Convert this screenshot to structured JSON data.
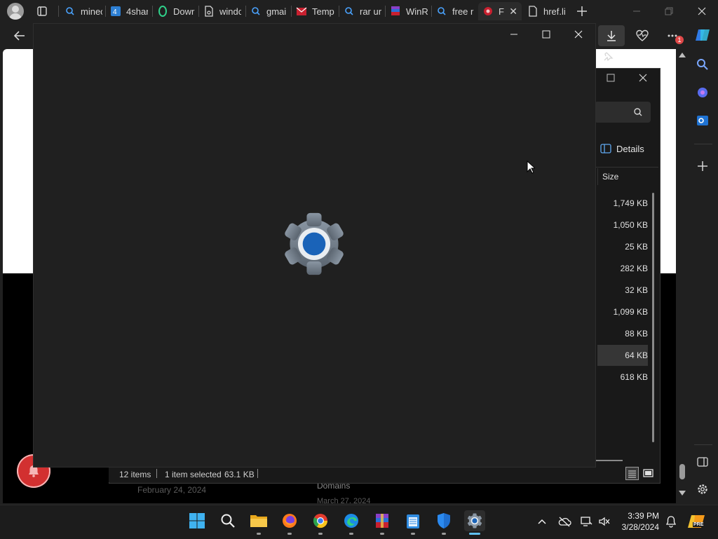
{
  "browser": {
    "tabs": [
      {
        "label": "minec",
        "icon": "search-icon"
      },
      {
        "label": "4shar",
        "icon": "4shared-icon"
      },
      {
        "label": "Dowr",
        "icon": "opera-icon"
      },
      {
        "label": "windc",
        "icon": "document-gear-icon"
      },
      {
        "label": "gmai",
        "icon": "search-icon"
      },
      {
        "label": "Temp",
        "icon": "mail-icon"
      },
      {
        "label": "rar ur",
        "icon": "search-icon"
      },
      {
        "label": "WinR",
        "icon": "winrar-icon"
      },
      {
        "label": "free r",
        "icon": "search-icon"
      },
      {
        "label": "F",
        "icon": "site-icon"
      },
      {
        "label": "href.li",
        "icon": "page-icon"
      }
    ],
    "notification_count": "1"
  },
  "webpage": {
    "date1": "February 24, 2024",
    "domains_label": "Domains",
    "date2": "March 27, 2024"
  },
  "explorer": {
    "details_label": "Details",
    "size_header": "Size",
    "sizes": [
      "1,749 KB",
      "1,050 KB",
      "25 KB",
      "282 KB",
      "32 KB",
      "1,099 KB",
      "88 KB",
      "64 KB",
      "618 KB"
    ],
    "selected_index": 7,
    "status_items": "12 items",
    "status_selected": "1 item selected",
    "status_size": "63.1 KB"
  },
  "settings_window": {
    "loading": true
  },
  "taskbar": {
    "time": "3:39 PM",
    "date": "3/28/2024",
    "copilot_badge": "PRE"
  }
}
